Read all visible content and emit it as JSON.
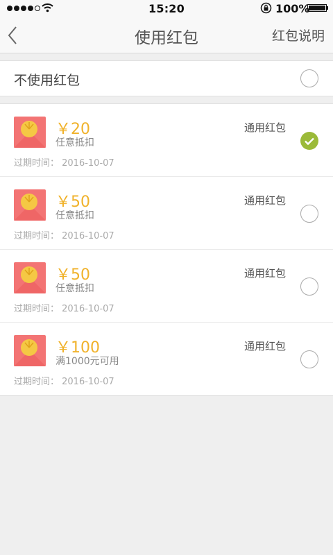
{
  "status_bar": {
    "time": "15:20",
    "battery": "100%"
  },
  "nav": {
    "title": "使用红包",
    "right_link": "红包说明"
  },
  "no_use": {
    "label": "不使用红包",
    "selected": false
  },
  "coupons": [
    {
      "amount": "￥20",
      "condition": "任意抵扣",
      "type": "通用红包",
      "expire": "过期时间： 2016-10-07",
      "selected": true
    },
    {
      "amount": "￥50",
      "condition": "任意抵扣",
      "type": "通用红包",
      "expire": "过期时间： 2016-10-07",
      "selected": false
    },
    {
      "amount": "￥50",
      "condition": "任意抵扣",
      "type": "通用红包",
      "expire": "过期时间： 2016-10-07",
      "selected": false
    },
    {
      "amount": "￥100",
      "condition": "满1000元可用",
      "type": "通用红包",
      "expire": "过期时间： 2016-10-07",
      "selected": false
    }
  ],
  "colors": {
    "accent": "#f0b22b",
    "selected": "#9bba39",
    "envelope": "#f36c6c"
  },
  "icons": {
    "back": "back-chevron-icon",
    "envelope": "red-envelope-icon",
    "check": "check-icon",
    "signal": "signal-dots-icon",
    "wifi": "wifi-icon",
    "lock": "rotation-lock-icon",
    "battery": "battery-icon"
  }
}
